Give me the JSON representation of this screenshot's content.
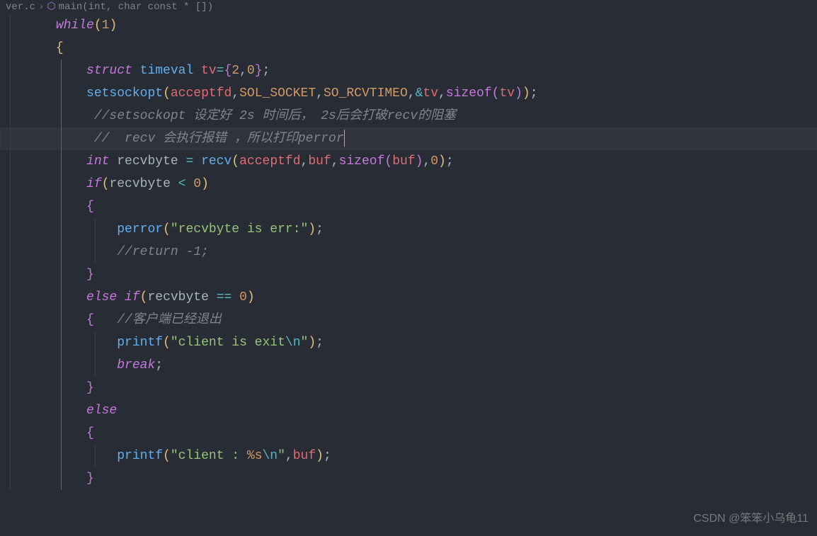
{
  "breadcrumb": {
    "file": "ver.c",
    "sep": "›",
    "symbol": "main(int, char const * [])"
  },
  "code": {
    "l1_while": "while",
    "l1_paren_o": "(",
    "l1_one": "1",
    "l1_paren_c": ")",
    "l2_brace": "{",
    "l3_struct": "struct",
    "l3_timeval": " timeval ",
    "l3_tv": "tv",
    "l3_eq": "=",
    "l3_bo": "{",
    "l3_2": "2",
    "l3_comma": ",",
    "l3_0": "0",
    "l3_bc": "}",
    "l3_semi": ";",
    "l4_fn": "setsockopt",
    "l4_po": "(",
    "l4_a1": "acceptfd",
    "l4_c": ",",
    "l4_a2": "SOL_SOCKET",
    "l4_a3": "SO_RCVTIMEO",
    "l4_amp": "&",
    "l4_tv": "tv",
    "l4_sz": "sizeof",
    "l4_po2": "(",
    "l4_tv2": "tv",
    "l4_pc2": ")",
    "l4_pc": ")",
    "l4_s": ";",
    "l5_cmt": "//setsockopt 设定好 2s 时间后， 2s后会打破recv的阻塞",
    "l6_cmt": "//  recv 会执行报错 ，所以打印perror",
    "l7_int": "int",
    "l7_rb": " recvbyte ",
    "l7_eq": "=",
    "l7_fn": " recv",
    "l7_po": "(",
    "l7_a1": "acceptfd",
    "l7_c": ",",
    "l7_a2": "buf",
    "l7_sz": "sizeof",
    "l7_po2": "(",
    "l7_buf": "buf",
    "l7_pc2": ")",
    "l7_0": "0",
    "l7_pc": ")",
    "l7_s": ";",
    "l8_if": "if",
    "l8_po": "(",
    "l8_rb": "recvbyte ",
    "l8_lt": "<",
    "l8_0": " 0",
    "l8_pc": ")",
    "l9_bo": "{",
    "l10_fn": "perror",
    "l10_po": "(",
    "l10_str": "\"recvbyte is err:\"",
    "l10_pc": ")",
    "l10_s": ";",
    "l11_cmt": "//return -1;",
    "l12_bc": "}",
    "l13_else": "else",
    "l13_if": " if",
    "l13_po": "(",
    "l13_rb": "recvbyte ",
    "l13_eq": "==",
    "l13_0": " 0",
    "l13_pc": ")",
    "l14_bo": "{",
    "l14_cmt": "   //客户端已经退出",
    "l15_fn": "printf",
    "l15_po": "(",
    "l15_str1": "\"client is exit",
    "l15_esc": "\\n",
    "l15_str2": "\"",
    "l15_pc": ")",
    "l15_s": ";",
    "l16_break": "break",
    "l16_s": ";",
    "l17_bc": "}",
    "l18_else": "else",
    "l19_bo": "{",
    "l20_fn": "printf",
    "l20_po": "(",
    "l20_str1": "\"client : ",
    "l20_fmt": "%s",
    "l20_esc": "\\n",
    "l20_str2": "\"",
    "l20_c": ",",
    "l20_buf": "buf",
    "l20_pc": ")",
    "l20_s": ";",
    "l21_bc": "}"
  },
  "watermark": "CSDN @笨笨小乌龟11",
  "statusbar": ""
}
